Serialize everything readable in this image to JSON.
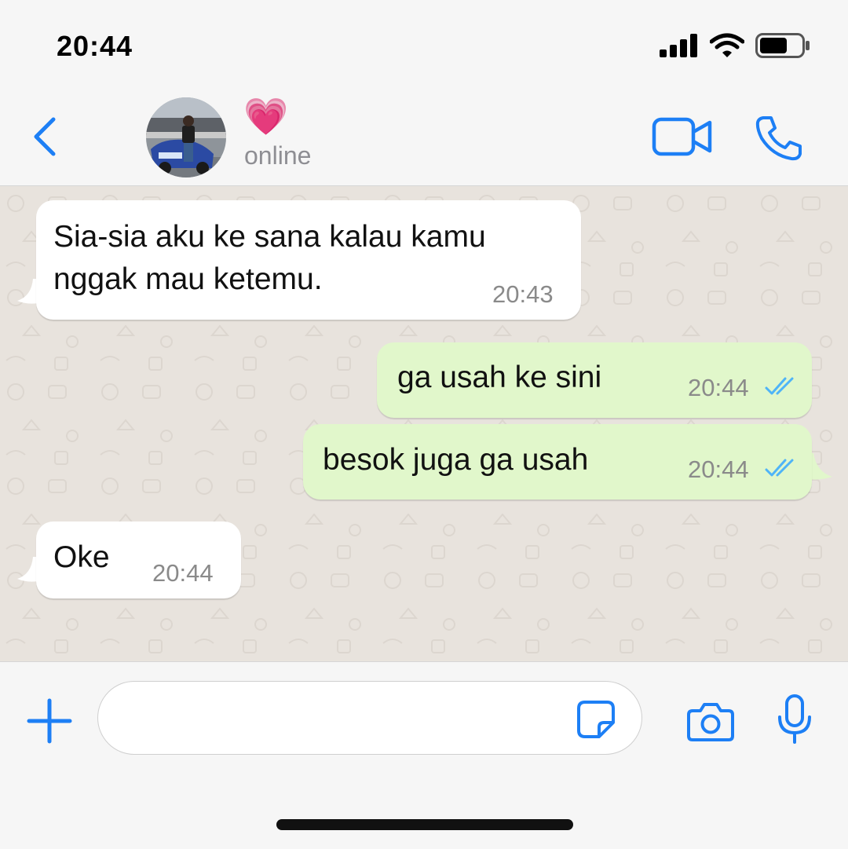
{
  "status_bar": {
    "time": "20:44"
  },
  "header": {
    "contact_name": "💗",
    "contact_status": "online"
  },
  "messages": [
    {
      "direction": "incoming",
      "lines": [
        "Sia-sia aku ke sana kalau kamu",
        "nggak mau ketemu."
      ],
      "time": "20:43"
    },
    {
      "direction": "outgoing",
      "lines": [
        "ga usah ke sini"
      ],
      "time": "20:44",
      "read": true
    },
    {
      "direction": "outgoing",
      "lines": [
        "besok juga ga usah"
      ],
      "time": "20:44",
      "read": true
    },
    {
      "direction": "incoming",
      "lines": [
        "Oke"
      ],
      "time": "20:44"
    }
  ],
  "input": {
    "value": "",
    "placeholder": ""
  },
  "icons": {
    "back": "chevron-left-icon",
    "video": "video-camera-icon",
    "call": "phone-icon",
    "plus": "plus-icon",
    "sticker": "sticker-icon",
    "camera": "camera-icon",
    "mic": "microphone-icon"
  },
  "colors": {
    "accent": "#1d7ff5",
    "incoming_bubble": "#ffffff",
    "outgoing_bubble": "#e1f7cb",
    "read_ticks": "#4fb4f7",
    "wallpaper": "#e8e3dd"
  }
}
